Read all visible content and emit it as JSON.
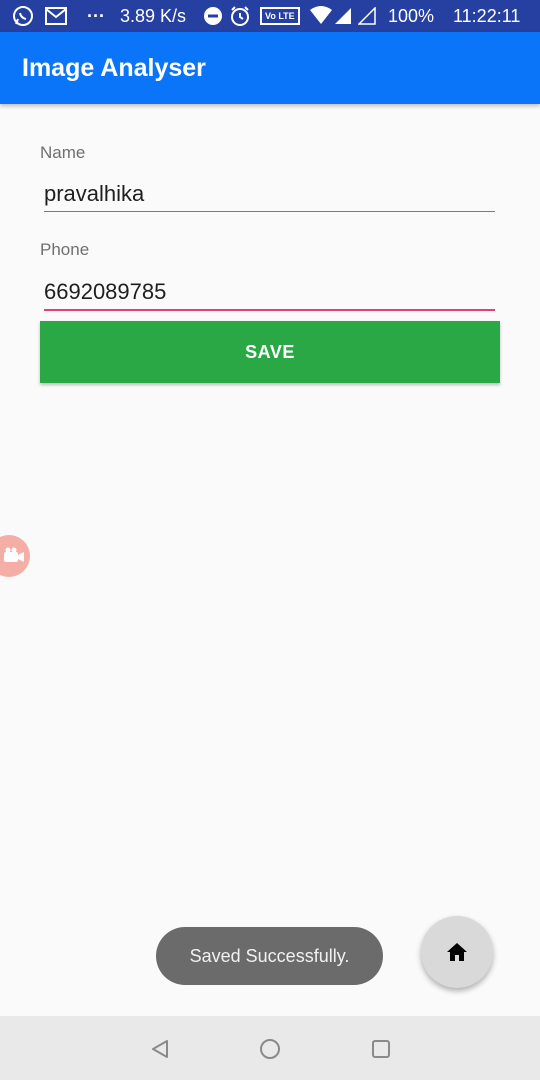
{
  "status_bar": {
    "net_speed": "3.89 K/s",
    "volte": "Vo LTE",
    "battery": "100%",
    "time": "11:22:11",
    "icons": [
      "whatsapp-icon",
      "gmail-icon",
      "more-dots-icon",
      "dnd-icon",
      "alarm-icon",
      "volte-icon",
      "wifi-icon",
      "signal-icon",
      "signal-empty-icon"
    ]
  },
  "app_bar": {
    "title": "Image Analyser"
  },
  "form": {
    "name_label": "Name",
    "name_value": "pravalhika",
    "phone_label": "Phone",
    "phone_value": "6692089785",
    "save_label": "SAVE"
  },
  "toast": {
    "message": "Saved Successfully."
  },
  "fab": {
    "icon": "home-icon"
  },
  "nav_bar": {
    "icons": [
      "back-icon",
      "home-circle-icon",
      "recents-icon"
    ]
  },
  "colors": {
    "status_bar": "#2540a0",
    "app_bar": "#0b75f9",
    "save_button": "#2aa845",
    "focused_underline": "#e0407a",
    "toast": "#6b6b6b",
    "fab": "#d9d9d9"
  }
}
